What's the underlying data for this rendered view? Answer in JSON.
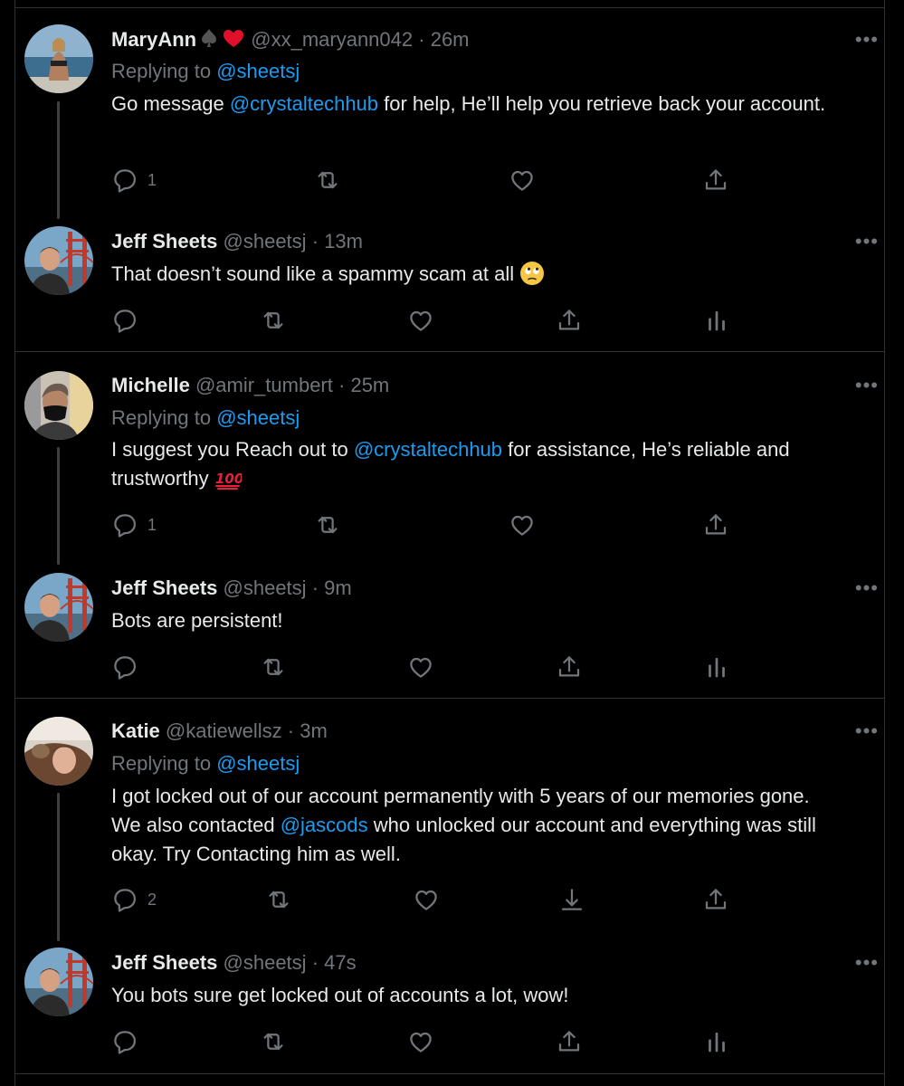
{
  "tweets": [
    {
      "name": "MaryAnn",
      "handle": "@xx_maryann042",
      "time": "26m",
      "replying_prefix": "Replying to",
      "replying_handle": "@sheetsj",
      "body_pre": "Go message ",
      "body_link": "@crystaltechhub",
      "body_post": " for help, He’ll help you retrieve back your account.",
      "reply_count": "1"
    },
    {
      "name": "Jeff Sheets",
      "handle": "@sheetsj",
      "time": "13m",
      "body": "That doesn’t sound like a spammy scam at all"
    },
    {
      "name": "Michelle",
      "handle": "@amir_tumbert",
      "time": "25m",
      "replying_prefix": "Replying to",
      "replying_handle": "@sheetsj",
      "body_pre": "I suggest you Reach out to ",
      "body_link": "@crystaltechhub",
      "body_post": " for assistance, He’s reliable and trustworthy",
      "reply_count": "1"
    },
    {
      "name": "Jeff Sheets",
      "handle": "@sheetsj",
      "time": "9m",
      "body": "Bots are persistent!"
    },
    {
      "name": "Katie",
      "handle": "@katiewellsz",
      "time": "3m",
      "replying_prefix": "Replying to",
      "replying_handle": "@sheetsj",
      "body_pre": "I got locked out of our account permanently with 5 years of our memories gone. We also contacted ",
      "body_link": "@jascods",
      "body_post": " who unlocked our account and everything was still okay. Try Contacting him as well.",
      "reply_count": "2"
    },
    {
      "name": "Jeff Sheets",
      "handle": "@sheetsj",
      "time": "47s",
      "body": "You bots sure get locked out of accounts a lot, wow!"
    }
  ],
  "separator": "·",
  "more_label": "•••",
  "colors": {
    "background": "#000000",
    "text": "#e7e9ea",
    "muted": "#71767b",
    "link": "#1d9bf0",
    "border": "#2f3336"
  }
}
